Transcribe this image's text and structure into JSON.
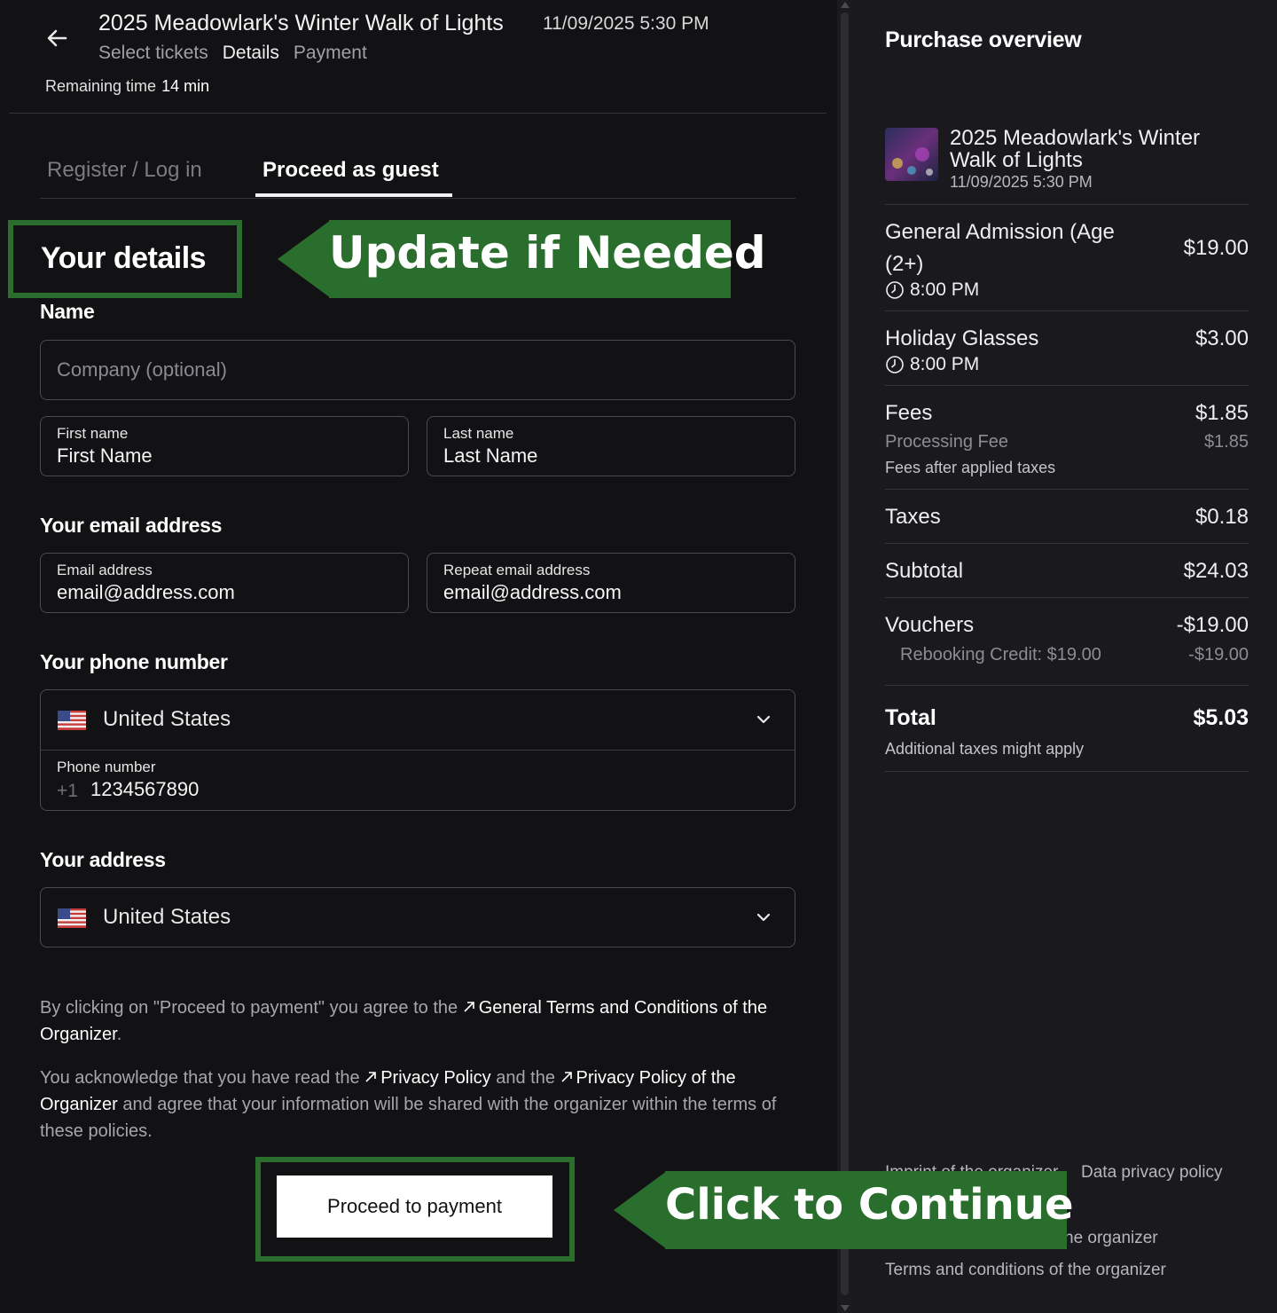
{
  "header": {
    "event_title": "2025 Meadowlark's Winter Walk of Lights",
    "event_datetime": "11/09/2025 5:30 PM",
    "steps": [
      "Select tickets",
      "Details",
      "Payment"
    ],
    "active_step": "Details",
    "remaining_label": "Remaining time",
    "remaining_value": "14 min"
  },
  "tabs": {
    "register": "Register / Log in",
    "guest": "Proceed as guest"
  },
  "annotations": {
    "update": "Update if Needed",
    "continue": "Click to Continue"
  },
  "form": {
    "details_heading": "Your details",
    "name_heading": "Name",
    "company_placeholder": "Company (optional)",
    "first_name_label": "First name",
    "first_name_value": "First Name",
    "last_name_label": "Last name",
    "last_name_value": "Last Name",
    "email_heading": "Your email address",
    "email_label": "Email address",
    "email_value": "email@address.com",
    "repeat_email_label": "Repeat email address",
    "repeat_email_value": "email@address.com",
    "phone_heading": "Your phone number",
    "phone_country": "United States",
    "phone_label": "Phone number",
    "phone_prefix": "+1",
    "phone_value": "1234567890",
    "address_heading": "Your address",
    "address_country": "United States"
  },
  "legal": {
    "p1_before": "By clicking on \"Proceed to payment\" you agree to the ",
    "p1_link": "General Terms and Conditions of the Organizer",
    "p1_after": ".",
    "p2_before": "You acknowledge that you have read the ",
    "p2_link1": "Privacy Policy",
    "p2_mid": " and the ",
    "p2_link2": "Privacy Policy of the Organizer",
    "p2_after": " and agree that your information will be shared with the organizer within the terms of these policies."
  },
  "proceed_label": "Proceed to payment",
  "overview": {
    "title": "Purchase overview",
    "event_name": "2025 Meadowlark's Winter Walk of Lights",
    "event_date": "11/09/2025 5:30 PM",
    "items": [
      {
        "name": "General Admission (Age (2+)",
        "price": "$19.00",
        "time": "8:00 PM"
      },
      {
        "name": "Holiday Glasses",
        "price": "$3.00",
        "time": "8:00 PM"
      }
    ],
    "fees_label": "Fees",
    "fees_value": "$1.85",
    "processing_label": "Processing Fee",
    "processing_value": "$1.85",
    "fees_note": "Fees after applied taxes",
    "taxes_label": "Taxes",
    "taxes_value": "$0.18",
    "subtotal_label": "Subtotal",
    "subtotal_value": "$24.03",
    "vouchers_label": "Vouchers",
    "vouchers_value": "-$19.00",
    "rebooking_label": "Rebooking Credit: $19.00",
    "rebooking_value": "-$19.00",
    "total_label": "Total",
    "total_value": "$5.03",
    "total_note": "Additional taxes might apply"
  },
  "footer": {
    "imprint": "Imprint of the organizer",
    "data_privacy": "Data privacy policy",
    "privacy_partial": "he organizer",
    "terms": "Terms and conditions of the organizer"
  },
  "colors": {
    "annotation_green": "#2a6e2e",
    "background": "#121215",
    "panel": "#1a1a1e"
  }
}
